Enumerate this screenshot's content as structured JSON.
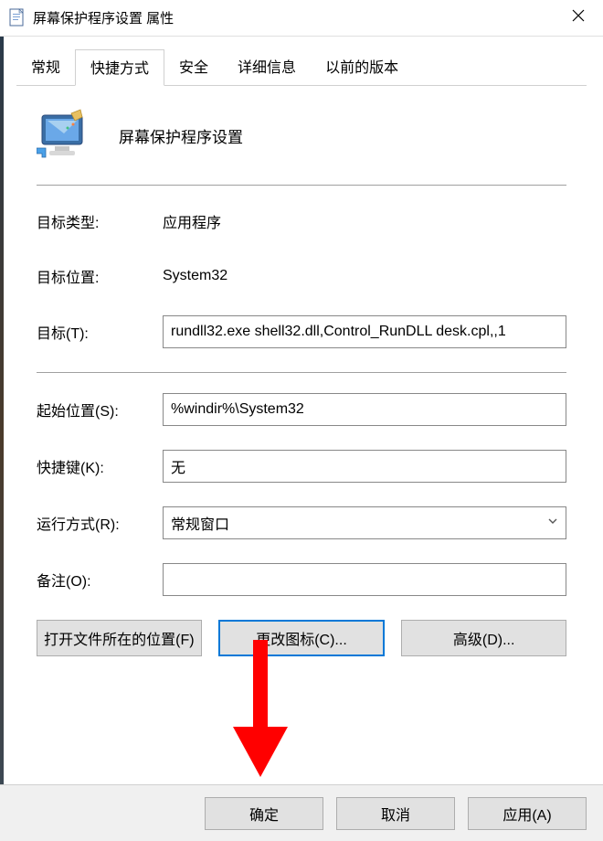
{
  "window": {
    "title": "屏幕保护程序设置 属性"
  },
  "tabs": {
    "general": "常规",
    "shortcut": "快捷方式",
    "security": "安全",
    "details": "详细信息",
    "previous": "以前的版本"
  },
  "header": {
    "label": "屏幕保护程序设置"
  },
  "fields": {
    "target_type": {
      "label": "目标类型:",
      "value": "应用程序"
    },
    "target_location": {
      "label": "目标位置:",
      "value": "System32"
    },
    "target": {
      "label": "目标(T):",
      "value": "rundll32.exe shell32.dll,Control_RunDLL desk.cpl,,1"
    },
    "start_in": {
      "label": "起始位置(S):",
      "value": "%windir%\\System32"
    },
    "shortcut_key": {
      "label": "快捷键(K):",
      "value": "无"
    },
    "run": {
      "label": "运行方式(R):",
      "value": "常规窗口"
    },
    "comment": {
      "label": "备注(O):",
      "value": ""
    }
  },
  "buttons": {
    "open_location": "打开文件所在的位置(F)",
    "change_icon": "更改图标(C)...",
    "advanced": "高级(D)..."
  },
  "footer": {
    "ok": "确定",
    "cancel": "取消",
    "apply": "应用(A)"
  }
}
